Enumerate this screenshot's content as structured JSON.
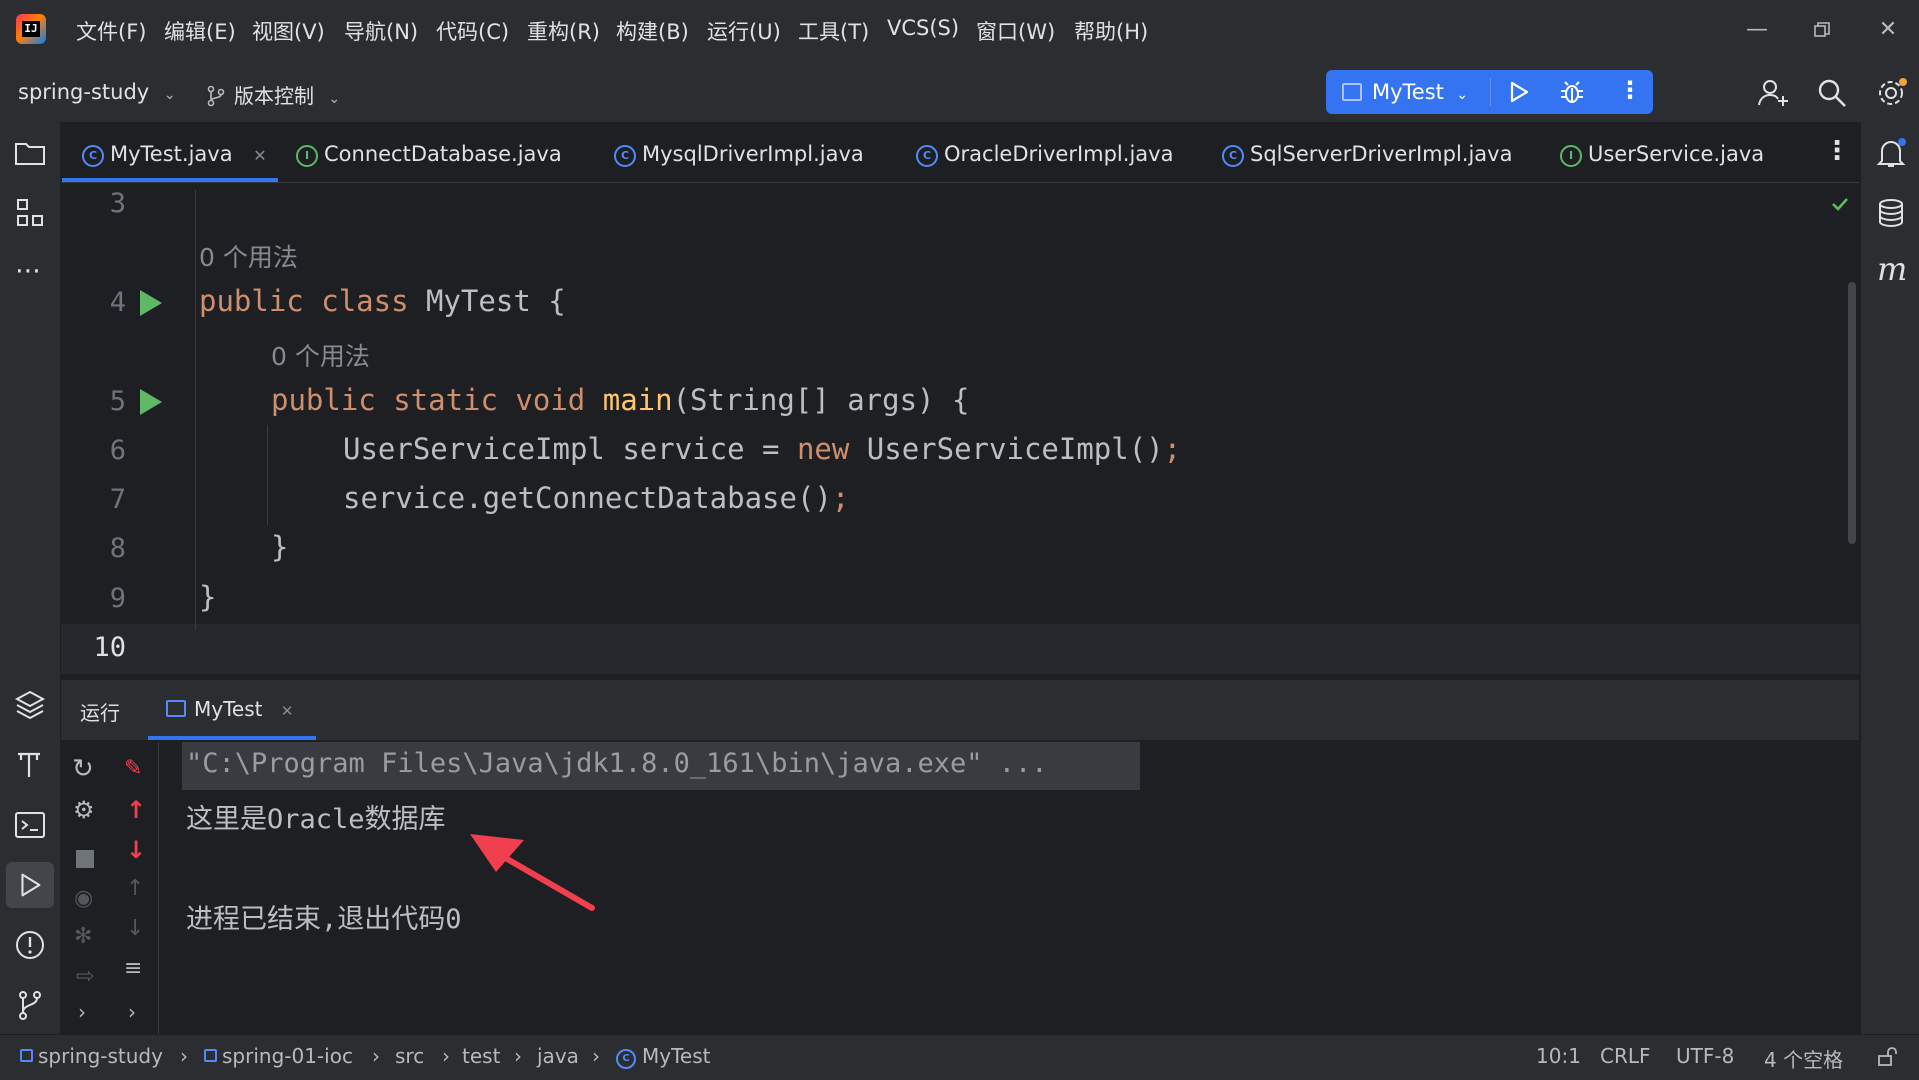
{
  "menu": [
    "文件(F)",
    "编辑(E)",
    "视图(V)",
    "导航(N)",
    "代码(C)",
    "重构(R)",
    "构建(B)",
    "运行(U)",
    "工具(T)",
    "VCS(S)",
    "窗口(W)",
    "帮助(H)"
  ],
  "toolbar": {
    "project": "spring-study",
    "vcs": "版本控制",
    "run_config": "MyTest"
  },
  "tabs": [
    {
      "label": "MyTest.java",
      "kind": "class",
      "active": true
    },
    {
      "label": "ConnectDatabase.java",
      "kind": "interface"
    },
    {
      "label": "MysqlDriverImpl.java",
      "kind": "class"
    },
    {
      "label": "OracleDriverImpl.java",
      "kind": "class"
    },
    {
      "label": "SqlServerDriverImpl.java",
      "kind": "class"
    },
    {
      "label": "UserService.java",
      "kind": "interface"
    }
  ],
  "editor": {
    "line_numbers": [
      "3",
      "4",
      "5",
      "6",
      "7",
      "8",
      "9",
      "10"
    ],
    "usage_hint": "0 个用法",
    "code": {
      "l4_public": "public",
      "l4_class": "class",
      "l4_name": "MyTest {",
      "l5_mods": "public static void",
      "l5_main": "main",
      "l5_rest": "(String[] args) {",
      "l6_a": "UserServiceImpl service = ",
      "l6_new": "new",
      "l6_b": " UserServiceImpl()",
      "l6_semi": ";",
      "l7_a": "service.getConnectDatabase()",
      "l7_semi": ";",
      "l8": "}",
      "l9": "}"
    }
  },
  "run_panel": {
    "title": "运行",
    "tab": "MyTest",
    "console": [
      "\"C:\\Program Files\\Java\\jdk1.8.0_161\\bin\\java.exe\" ...",
      "这里是Oracle数据库",
      "",
      "进程已结束,退出代码0"
    ]
  },
  "breadcrumbs": [
    "spring-study",
    "spring-01-ioc",
    "src",
    "test",
    "java",
    "MyTest"
  ],
  "status": {
    "position": "10:1",
    "line_sep": "CRLF",
    "encoding": "UTF-8",
    "indent": "4 个空格"
  },
  "colors": {
    "accent": "#3574f0",
    "keyword": "#cf8e6d",
    "function_decl": "#ffc66d",
    "run_green": "#5fb865",
    "arrow_red": "#f0404f"
  }
}
